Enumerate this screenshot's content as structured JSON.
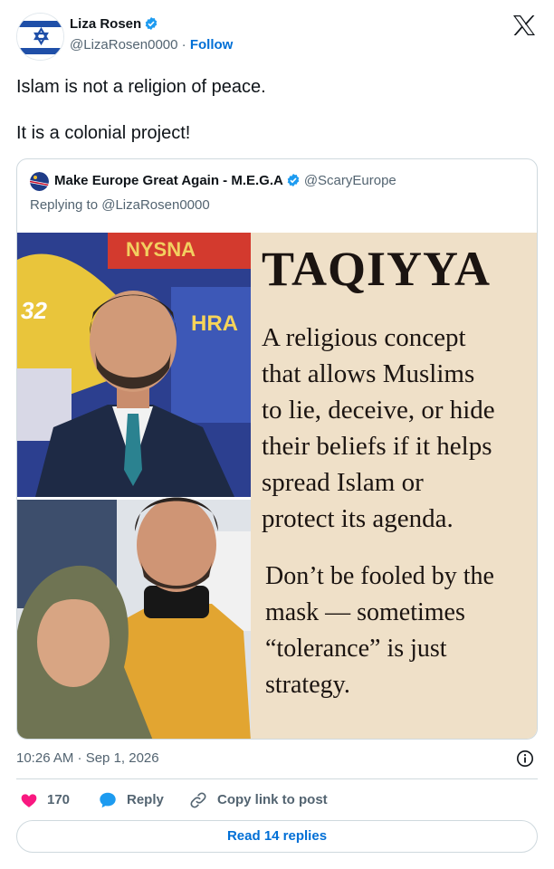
{
  "author": {
    "name": "Liza Rosen",
    "handle": "@LizaRosen0000",
    "separator": "·",
    "follow_label": "Follow"
  },
  "tweet": {
    "lines": [
      "Islam is not a religion of peace.",
      "It is a colonial project!"
    ]
  },
  "quote": {
    "name": "Make Europe Great Again - M.E.G.A",
    "handle": "@ScaryEurope",
    "replying_to": "Replying to @LizaRosen0000",
    "meme": {
      "photo_sign_top": "NYSNA",
      "photo_sign_left": "32",
      "photo_sign_mid": "HRA",
      "title": "TAQIYYA",
      "body": [
        "A religious concept",
        "that allows Muslims",
        "to lie, deceive, or hide",
        "their beliefs if it helps",
        "spread Islam or",
        "protect its agenda."
      ],
      "footer": [
        "Don’t be fooled by the",
        "mask — sometimes",
        "“tolerance” is just",
        "strategy."
      ]
    }
  },
  "meta": {
    "timestamp": "10:26 AM · Sep 1, 2026"
  },
  "actions": {
    "like_count": "170",
    "reply_label": "Reply",
    "copy_label": "Copy link to post",
    "read_replies": "Read 14 replies"
  },
  "colors": {
    "like": "#f91880",
    "link": "#006fd6",
    "verified": "#1d9bf0",
    "meme_bg": "#efe0c8"
  },
  "icons": [
    "verified-badge-icon",
    "x-logo-icon",
    "info-icon",
    "heart-icon",
    "reply-bubble-icon",
    "link-icon"
  ]
}
